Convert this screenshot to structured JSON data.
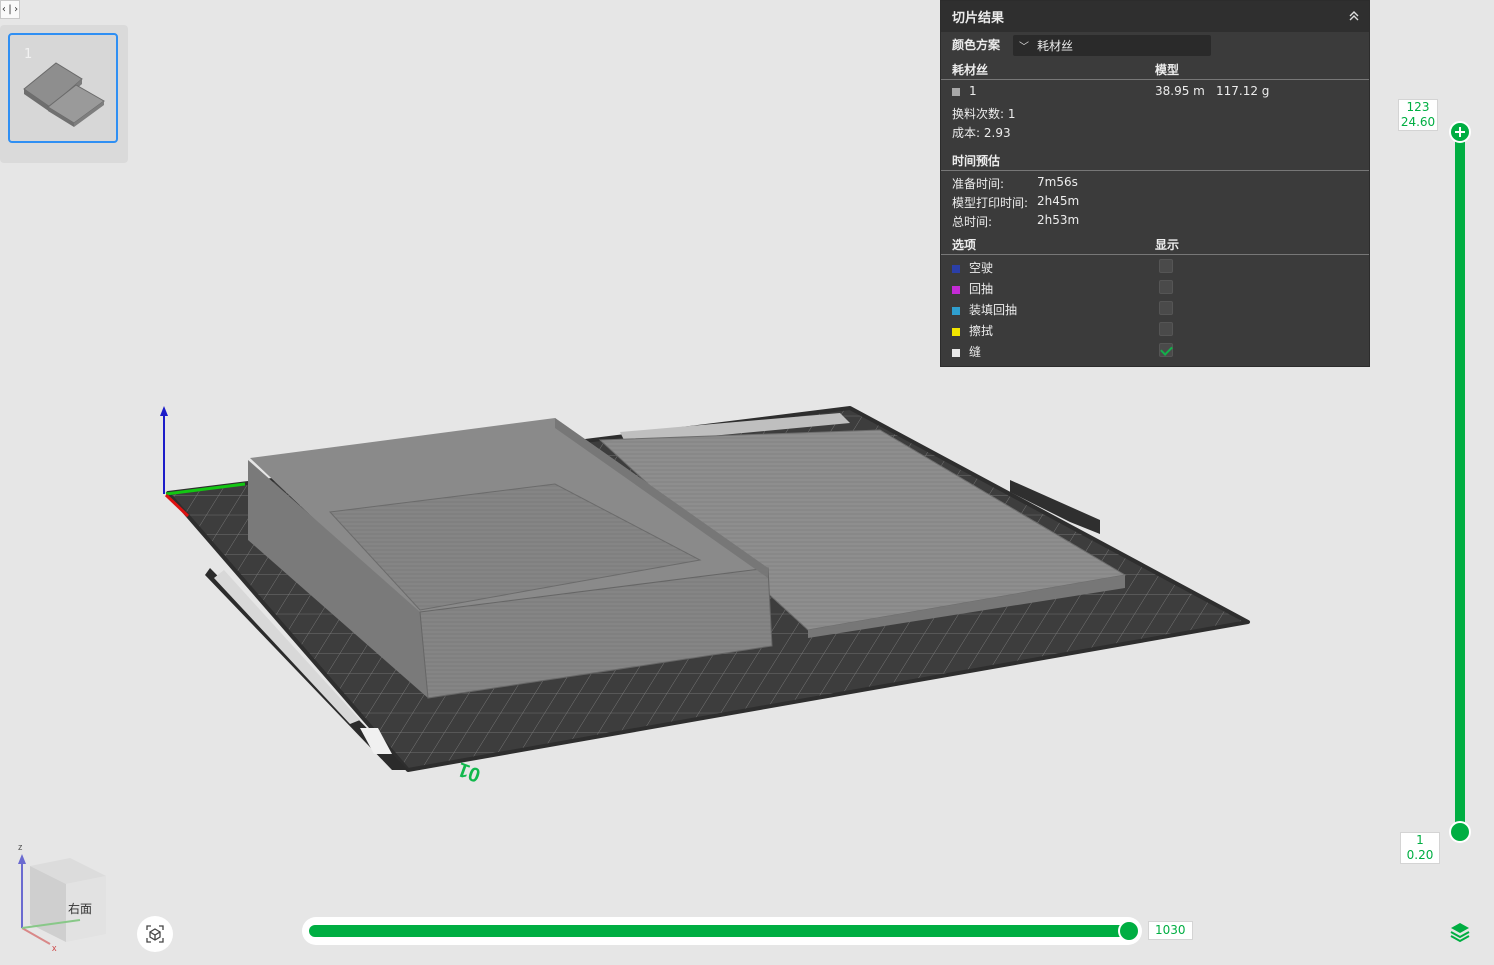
{
  "toolbar": {
    "collapse_label": "‹|›"
  },
  "plates": [
    {
      "number": "1"
    }
  ],
  "panel": {
    "title": "切片结果",
    "color_scheme_label": "颜色方案",
    "color_scheme_value": "耗材丝",
    "filament_header": "耗材丝",
    "model_header": "模型",
    "filament": {
      "id": "1",
      "length": "38.95 m",
      "weight": "117.12 g",
      "color": "#a8a8a8"
    },
    "change_count_label": "换料次数:",
    "change_count": "1",
    "cost_label": "成本:",
    "cost": "2.93",
    "time_header": "时间预估",
    "prep_time_label": "准备时间:",
    "prep_time": "7m56s",
    "model_time_label": "模型打印时间:",
    "model_time": "2h45m",
    "total_time_label": "总时间:",
    "total_time": "2h53m",
    "options_header": "选项",
    "display_header": "显示",
    "options": [
      {
        "label": "空驶",
        "color": "#2b3fa8",
        "checked": false
      },
      {
        "label": "回抽",
        "color": "#c42bd6",
        "checked": false
      },
      {
        "label": "装填回抽",
        "color": "#2f9fcf",
        "checked": false
      },
      {
        "label": "擦拭",
        "color": "#f2e600",
        "checked": false
      },
      {
        "label": "缝",
        "color": "#e8e8e8",
        "checked": true
      }
    ]
  },
  "layer_slider": {
    "top_layer": "123",
    "top_height": "24.60",
    "bottom_layer": "1",
    "bottom_height": "0.20"
  },
  "move_slider": {
    "value": "1030"
  },
  "nav_cube": {
    "face_label": "右面",
    "axis_z": "z",
    "axis_x": "x"
  },
  "plate_label": "01",
  "colors": {
    "accent": "#00ae42",
    "panel_bg": "#3b3b3b"
  }
}
